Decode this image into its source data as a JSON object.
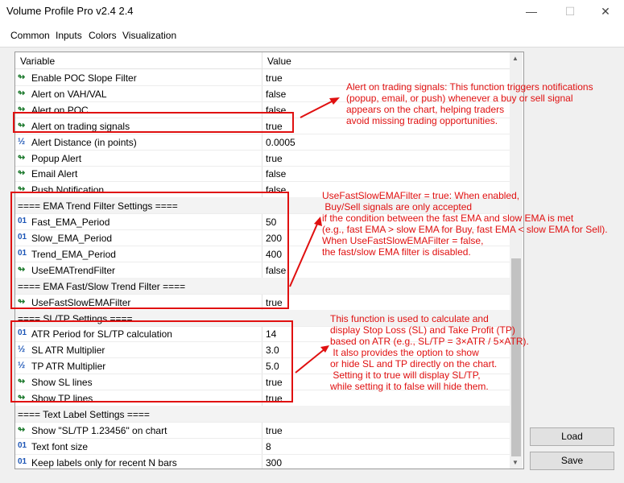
{
  "window": {
    "title": "Volume Profile Pro v2.4 2.4"
  },
  "tabs": [
    "Common",
    "Inputs",
    "Colors",
    "Visualization"
  ],
  "table": {
    "columns": [
      "Variable",
      "Value"
    ],
    "rows": [
      {
        "icon": "arrow",
        "name": "Enable POC Slope Filter",
        "value": "true"
      },
      {
        "icon": "arrow",
        "name": "Alert on VAH/VAL",
        "value": "false"
      },
      {
        "icon": "arrow",
        "name": "Alert on POC",
        "value": "false"
      },
      {
        "icon": "arrow",
        "name": "Alert on trading signals",
        "value": "true"
      },
      {
        "icon": "half",
        "name": "Alert Distance (in points)",
        "value": "0.0005"
      },
      {
        "icon": "arrow",
        "name": "Popup Alert",
        "value": "true"
      },
      {
        "icon": "arrow",
        "name": "Email Alert",
        "value": "false"
      },
      {
        "icon": "arrow",
        "name": "Push Notification",
        "value": "false"
      },
      {
        "icon": "none",
        "name": "==== EMA Trend Filter Settings ====",
        "value": ""
      },
      {
        "icon": "num",
        "name": "Fast_EMA_Period",
        "value": "50"
      },
      {
        "icon": "num",
        "name": "Slow_EMA_Period",
        "value": "200"
      },
      {
        "icon": "num",
        "name": "Trend_EMA_Period",
        "value": "400"
      },
      {
        "icon": "arrow",
        "name": "UseEMATrendFilter",
        "value": "false"
      },
      {
        "icon": "none",
        "name": "==== EMA Fast/Slow Trend Filter ====",
        "value": ""
      },
      {
        "icon": "arrow",
        "name": "UseFastSlowEMAFilter",
        "value": "true"
      },
      {
        "icon": "none",
        "name": "==== SL/TP Settings ====",
        "value": ""
      },
      {
        "icon": "num",
        "name": "ATR Period for SL/TP calculation",
        "value": "14"
      },
      {
        "icon": "half",
        "name": "SL ATR Multiplier",
        "value": "3.0"
      },
      {
        "icon": "half",
        "name": "TP ATR Multiplier",
        "value": "5.0"
      },
      {
        "icon": "arrow",
        "name": "Show SL lines",
        "value": "true"
      },
      {
        "icon": "arrow",
        "name": "Show TP lines",
        "value": "true"
      },
      {
        "icon": "none",
        "name": "==== Text Label Settings ====",
        "value": ""
      },
      {
        "icon": "arrow",
        "name": "Show \"SL/TP 1.23456\" on chart",
        "value": "true"
      },
      {
        "icon": "num",
        "name": "Text font size",
        "value": "8"
      },
      {
        "icon": "num",
        "name": "Keep labels only for recent N bars",
        "value": "300"
      }
    ]
  },
  "buttons": {
    "load": "Load",
    "save": "Save"
  },
  "notes": {
    "alert": "Alert on trading signals: This function triggers notifications\n(popup, email, or push) whenever a buy or sell signal\nappears on the chart, helping traders\navoid missing trading opportunities.",
    "ema": "UseFastSlowEMAFilter = true: When enabled,\n Buy/Sell signals are only accepted\nif the condition between the fast EMA and slow EMA is met\n(e.g., fast EMA > slow EMA for Buy, fast EMA < slow EMA for Sell).\nWhen UseFastSlowEMAFilter = false,\nthe fast/slow EMA filter is disabled.",
    "sltp": "This function is used to calculate and\ndisplay Stop Loss (SL) and Take Profit (TP)\nbased on ATR (e.g., SL/TP = 3×ATR / 5×ATR).\n It also provides the option to show\nor hide SL and TP directly on the chart.\n Setting it to true will display SL/TP,\nwhile setting it to false will hide them."
  },
  "colors": {
    "annotation": "#e01010",
    "arrow_icon": "#1e7a2e",
    "number_icon": "#1c55b6"
  }
}
